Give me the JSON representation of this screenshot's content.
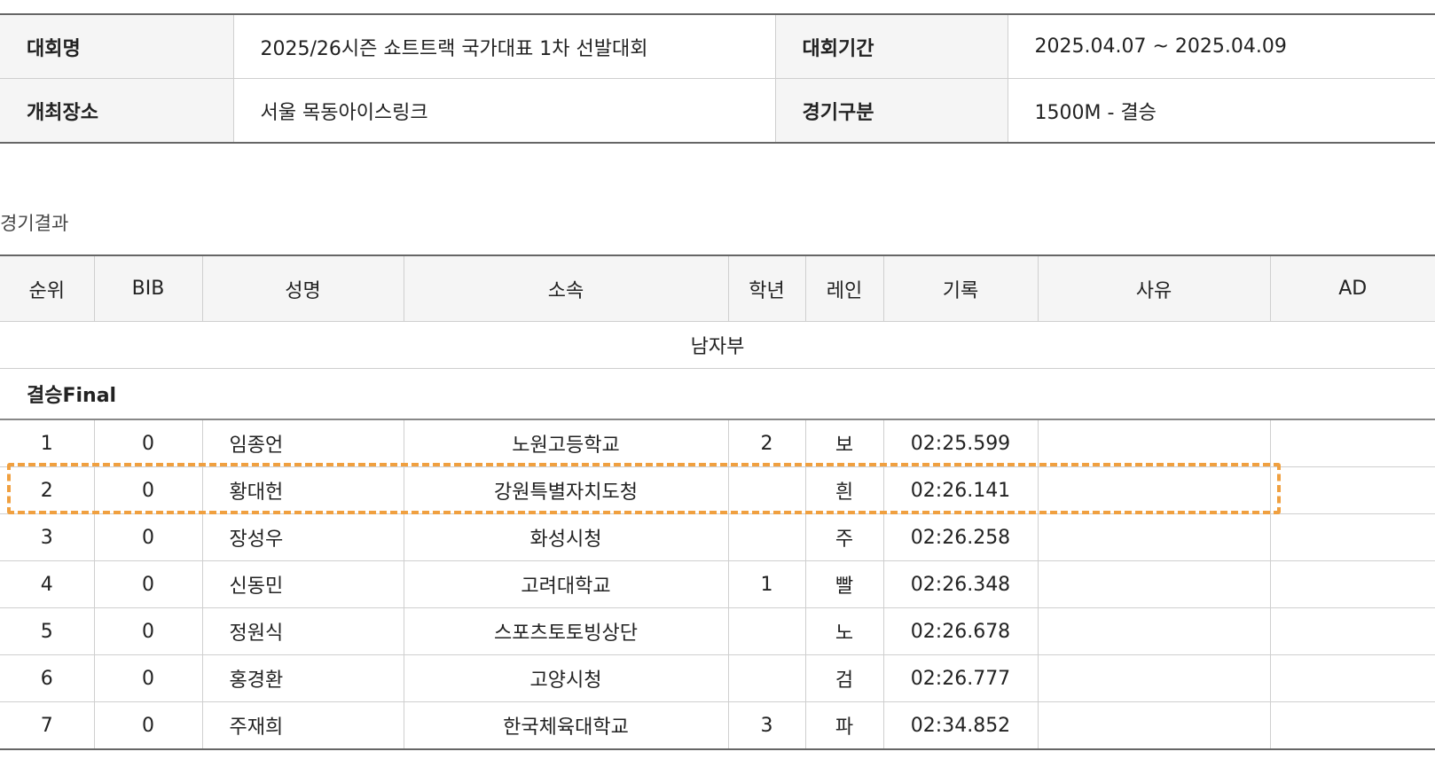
{
  "info": {
    "rows": [
      [
        {
          "label": "대회명",
          "value": "2025/26시즌 쇼트트랙 국가대표 1차 선발대회"
        },
        {
          "label": "대회기간",
          "value": "2025.04.07 ~ 2025.04.09"
        }
      ],
      [
        {
          "label": "개최장소",
          "value": "서울 목동아이스링크"
        },
        {
          "label": "경기구분",
          "value": "1500M - 결승"
        }
      ]
    ]
  },
  "results": {
    "title": "경기결과",
    "headers": [
      "순위",
      "BIB",
      "성명",
      "소속",
      "학년",
      "레인",
      "기록",
      "사유",
      "AD"
    ],
    "group": "남자부",
    "round": "결승Final",
    "rows": [
      [
        "1",
        "0",
        "임종언",
        "노원고등학교",
        "2",
        "보",
        "02:25.599",
        "",
        ""
      ],
      [
        "2",
        "0",
        "황대헌",
        "강원특별자치도청",
        "",
        "흰",
        "02:26.141",
        "",
        ""
      ],
      [
        "3",
        "0",
        "장성우",
        "화성시청",
        "",
        "주",
        "02:26.258",
        "",
        ""
      ],
      [
        "4",
        "0",
        "신동민",
        "고려대학교",
        "1",
        "빨",
        "02:26.348",
        "",
        ""
      ],
      [
        "5",
        "0",
        "정원식",
        "스포츠토토빙상단",
        "",
        "노",
        "02:26.678",
        "",
        ""
      ],
      [
        "6",
        "0",
        "홍경환",
        "고양시청",
        "",
        "검",
        "02:26.777",
        "",
        ""
      ],
      [
        "7",
        "0",
        "주재희",
        "한국체육대학교",
        "3",
        "파",
        "02:34.852",
        "",
        ""
      ]
    ]
  },
  "colors": {
    "highlight": "#f0a040",
    "header_bg": "#f5f5f5"
  }
}
